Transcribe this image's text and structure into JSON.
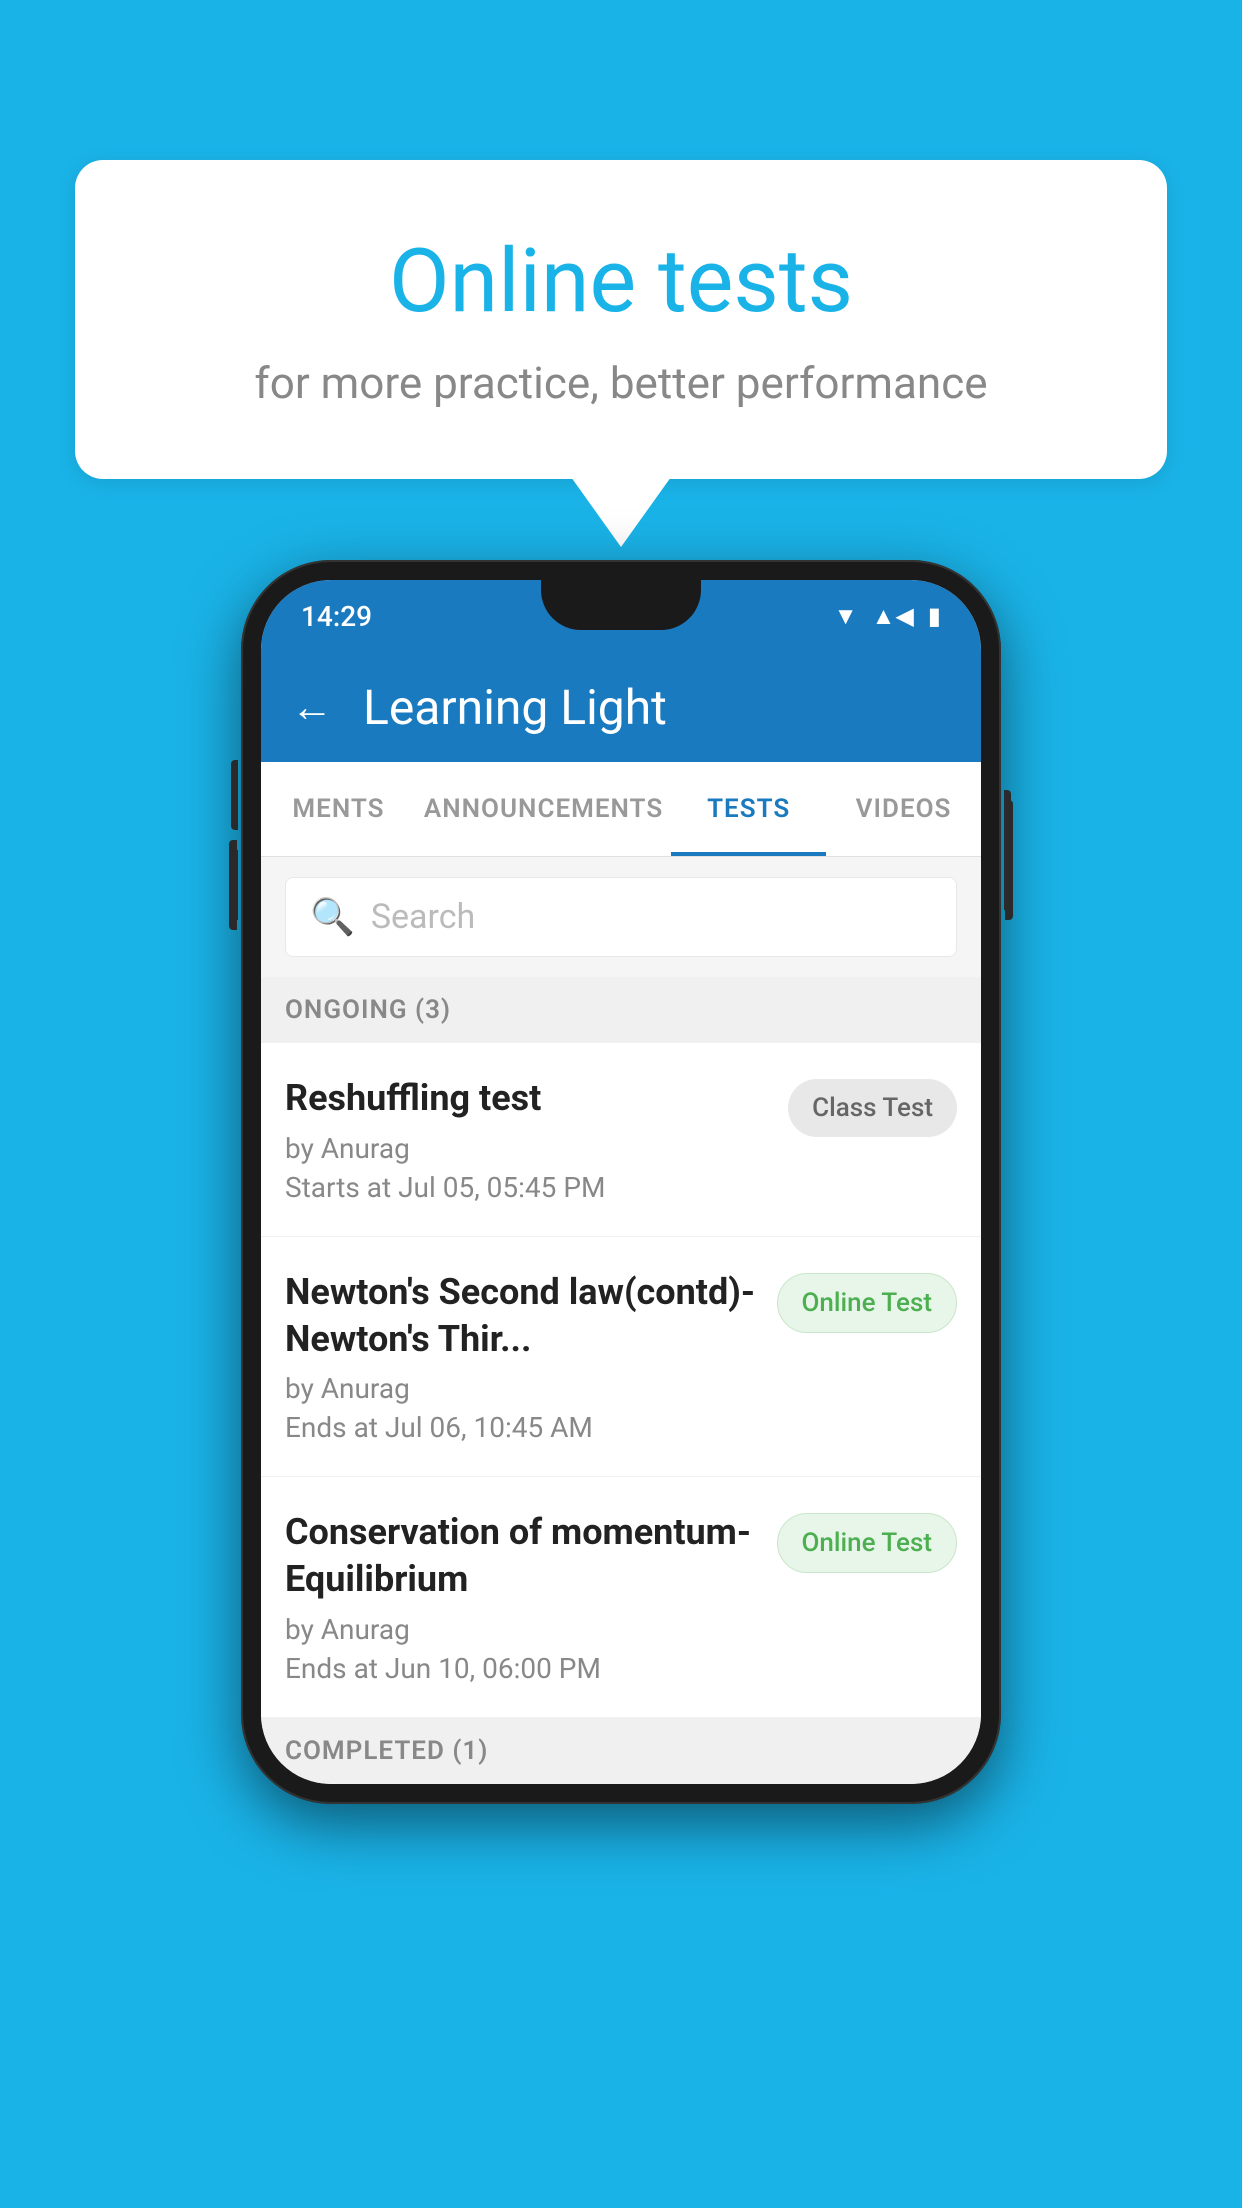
{
  "background_color": "#1ab3e8",
  "speech_bubble": {
    "title": "Online tests",
    "subtitle": "for more practice, better performance"
  },
  "phone": {
    "status_bar": {
      "time": "14:29",
      "icons": [
        "wifi",
        "signal",
        "battery"
      ]
    },
    "app_bar": {
      "title": "Learning Light",
      "back_label": "←"
    },
    "tabs": [
      {
        "label": "MENTS",
        "active": false
      },
      {
        "label": "ANNOUNCEMENTS",
        "active": false
      },
      {
        "label": "TESTS",
        "active": true
      },
      {
        "label": "VIDEOS",
        "active": false
      }
    ],
    "search": {
      "placeholder": "Search"
    },
    "sections": [
      {
        "header": "ONGOING (3)",
        "items": [
          {
            "name": "Reshuffling test",
            "author": "by Anurag",
            "date": "Starts at  Jul 05, 05:45 PM",
            "badge": "Class Test",
            "badge_type": "class"
          },
          {
            "name": "Newton's Second law(contd)-Newton's Thir...",
            "author": "by Anurag",
            "date": "Ends at  Jul 06, 10:45 AM",
            "badge": "Online Test",
            "badge_type": "online"
          },
          {
            "name": "Conservation of momentum-Equilibrium",
            "author": "by Anurag",
            "date": "Ends at  Jun 10, 06:00 PM",
            "badge": "Online Test",
            "badge_type": "online"
          }
        ]
      },
      {
        "header": "COMPLETED (1)",
        "items": []
      }
    ]
  }
}
